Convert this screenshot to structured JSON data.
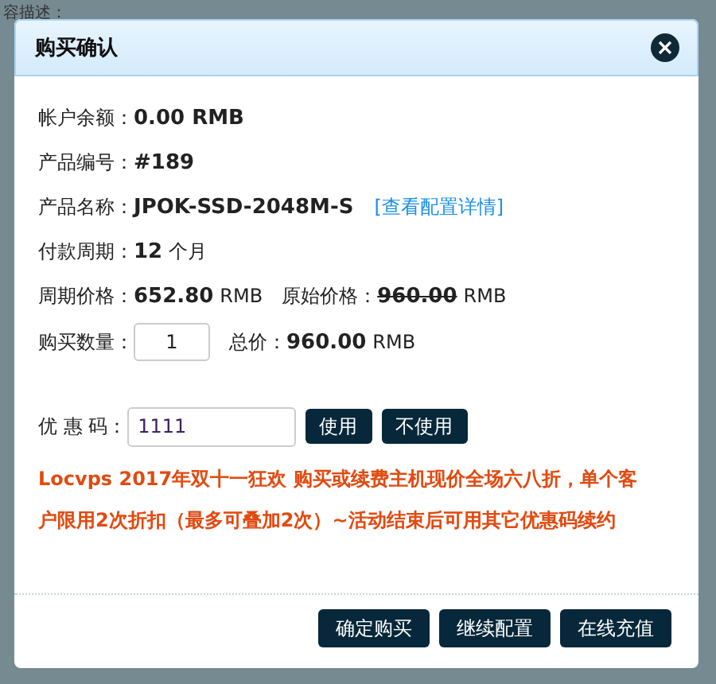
{
  "background": {
    "label": "容描述："
  },
  "dialog": {
    "title": "购买确认"
  },
  "rows": [
    {
      "kind": "plain",
      "label": "帐户余额：",
      "value": "0.00 RMB"
    },
    {
      "kind": "plain",
      "label": "产品编号：",
      "value": "#189"
    },
    {
      "kind": "link",
      "label": "产品名称：",
      "value": "JPOK-SSD-2048M-S",
      "link": "[查看配置详情]"
    },
    {
      "kind": "unit",
      "label": "付款周期：",
      "value": "12",
      "unit": "个月"
    }
  ],
  "prices": {
    "period_label": "周期价格：",
    "period_value": "652.80",
    "period_unit": "RMB",
    "original_label": "原始价格：",
    "original_value": "960.00",
    "original_unit": "RMB"
  },
  "quantity": {
    "label": "购买数量：",
    "value": "1",
    "total_label": "总价：",
    "total_value": "960.00",
    "total_unit": "RMB"
  },
  "coupon": {
    "label": "优 惠 码：",
    "value": "1111",
    "buttons": [
      "使用",
      "不使用"
    ]
  },
  "promo": "Locvps 2017年双十一狂欢 购买或续费主机现价全场六八折，单个客户限用2次折扣（最多可叠加2次）~活动结束后可用其它优惠码续约",
  "footer_buttons": [
    "确定购买",
    "继续配置",
    "在线充值"
  ]
}
